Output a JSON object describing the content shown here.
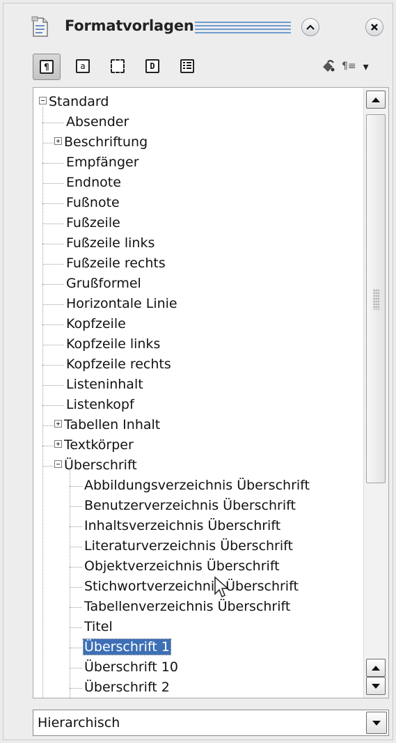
{
  "window": {
    "title": "Formatvorlagen",
    "title_icon": "styles-document-icon",
    "collapse_icon": "chevron-up-icon",
    "close_icon": "close-icon"
  },
  "toolbar": {
    "buttons": [
      {
        "name": "paragraph-styles-icon",
        "glyph": "¶",
        "active": true
      },
      {
        "name": "character-styles-icon",
        "glyph": "a",
        "active": false
      },
      {
        "name": "frame-styles-icon",
        "glyph": "",
        "active": false
      },
      {
        "name": "page-styles-icon",
        "glyph": "D",
        "active": false
      },
      {
        "name": "list-styles-icon",
        "glyph": "",
        "active": false
      }
    ],
    "fill_format_icon": "paint-bucket-icon",
    "new_style_icon": "pilcrow-menu-icon",
    "new_style_glyph": "¶≡",
    "dropdown_arrow": "▾"
  },
  "tree": {
    "items": [
      {
        "label": "Standard",
        "level": 0,
        "expander": "minus"
      },
      {
        "label": "Absender",
        "level": 1
      },
      {
        "label": "Beschriftung",
        "level": 1,
        "expander": "plus"
      },
      {
        "label": "Empfänger",
        "level": 1
      },
      {
        "label": "Endnote",
        "level": 1
      },
      {
        "label": "Fußnote",
        "level": 1
      },
      {
        "label": "Fußzeile",
        "level": 1
      },
      {
        "label": "Fußzeile links",
        "level": 1
      },
      {
        "label": "Fußzeile rechts",
        "level": 1
      },
      {
        "label": "Grußformel",
        "level": 1
      },
      {
        "label": "Horizontale Linie",
        "level": 1
      },
      {
        "label": "Kopfzeile",
        "level": 1
      },
      {
        "label": "Kopfzeile links",
        "level": 1
      },
      {
        "label": "Kopfzeile rechts",
        "level": 1
      },
      {
        "label": "Listeninhalt",
        "level": 1
      },
      {
        "label": "Listenkopf",
        "level": 1
      },
      {
        "label": "Tabellen Inhalt",
        "level": 1,
        "expander": "plus"
      },
      {
        "label": "Textkörper",
        "level": 1,
        "expander": "plus"
      },
      {
        "label": "Überschrift",
        "level": 1,
        "expander": "minus"
      },
      {
        "label": "Abbildungsverzeichnis Überschrift",
        "level": 2
      },
      {
        "label": "Benutzerverzeichnis Überschrift",
        "level": 2
      },
      {
        "label": "Inhaltsverzeichnis Überschrift",
        "level": 2
      },
      {
        "label": "Literaturverzeichnis Überschrift",
        "level": 2
      },
      {
        "label": "Objektverzeichnis Überschrift",
        "level": 2
      },
      {
        "label": "Stichwortverzeichnis Überschrift",
        "level": 2
      },
      {
        "label": "Tabellenverzeichnis Überschrift",
        "level": 2
      },
      {
        "label": "Titel",
        "level": 2
      },
      {
        "label": "Überschrift 1",
        "level": 2,
        "selected": true
      },
      {
        "label": "Überschrift 10",
        "level": 2
      },
      {
        "label": "Überschrift 2",
        "level": 2
      }
    ]
  },
  "filter": {
    "selected": "Hierarchisch"
  },
  "colors": {
    "selection": "#3d6fb6",
    "title_accent": "#6f9bd1"
  }
}
